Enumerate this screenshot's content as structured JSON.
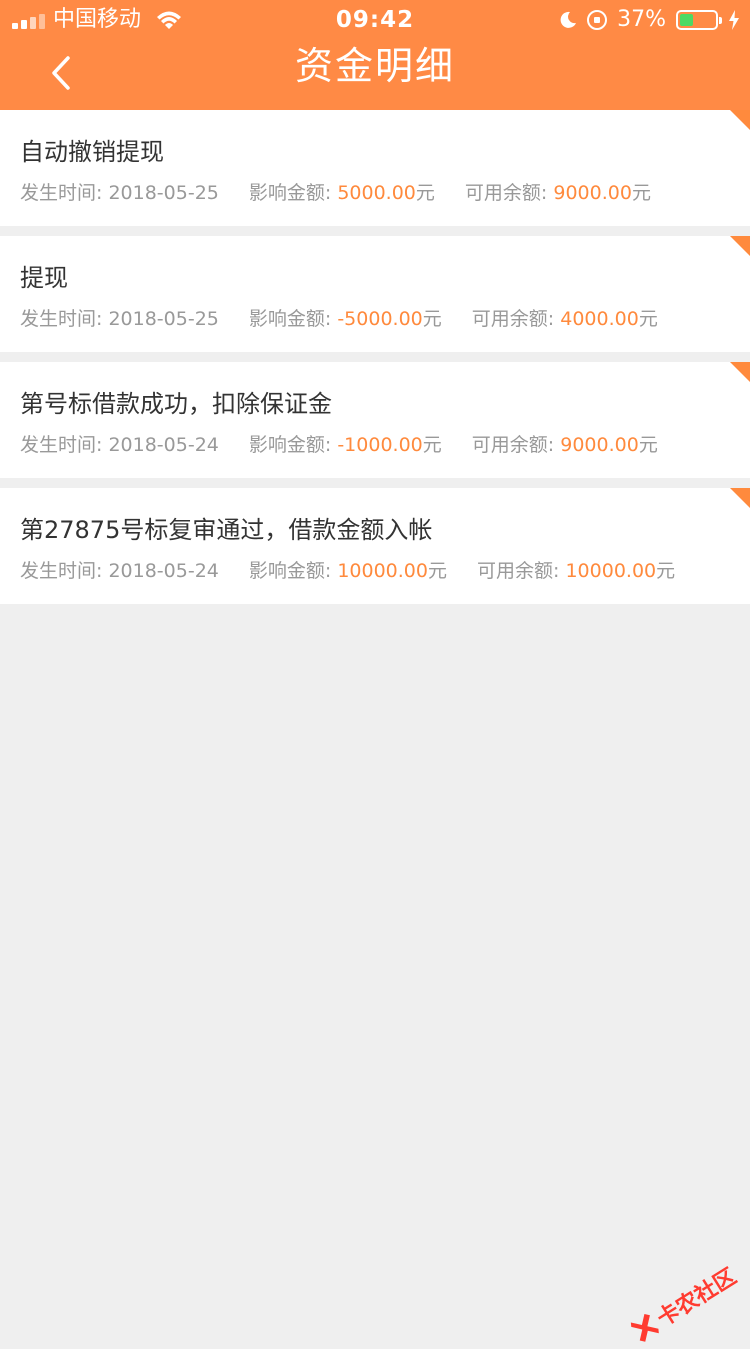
{
  "status_bar": {
    "carrier": "中国移动",
    "time": "09:42",
    "battery_percent": "37%",
    "battery_level": 0.37,
    "icons": [
      "signal-icon",
      "wifi-icon",
      "moon-icon",
      "orientation-lock-icon",
      "battery-icon",
      "charging-icon"
    ]
  },
  "navbar": {
    "title": "资金明细",
    "back_icon": "chevron-left-icon"
  },
  "colors": {
    "accent": "#ff8a45",
    "highlight": "#ff8a3d",
    "background": "#efefef",
    "battery_green": "#4cd964"
  },
  "labels": {
    "time": "发生时间: ",
    "amount": "影响金额: ",
    "balance": "可用余额: ",
    "unit": "元"
  },
  "records": [
    {
      "title": "自动撤销提现",
      "date": "2018-05-25",
      "amount": "5000.00",
      "balance": "9000.00"
    },
    {
      "title": "提现",
      "date": "2018-05-25",
      "amount": "-5000.00",
      "balance": "4000.00"
    },
    {
      "title": "第号标借款成功，扣除保证金",
      "date": "2018-05-24",
      "amount": "-1000.00",
      "balance": "9000.00"
    },
    {
      "title": "第27875号标复审通过，借款金额入帐",
      "date": "2018-05-24",
      "amount": "10000.00",
      "balance": "10000.00"
    }
  ],
  "watermark": {
    "text": "卡农社区"
  }
}
